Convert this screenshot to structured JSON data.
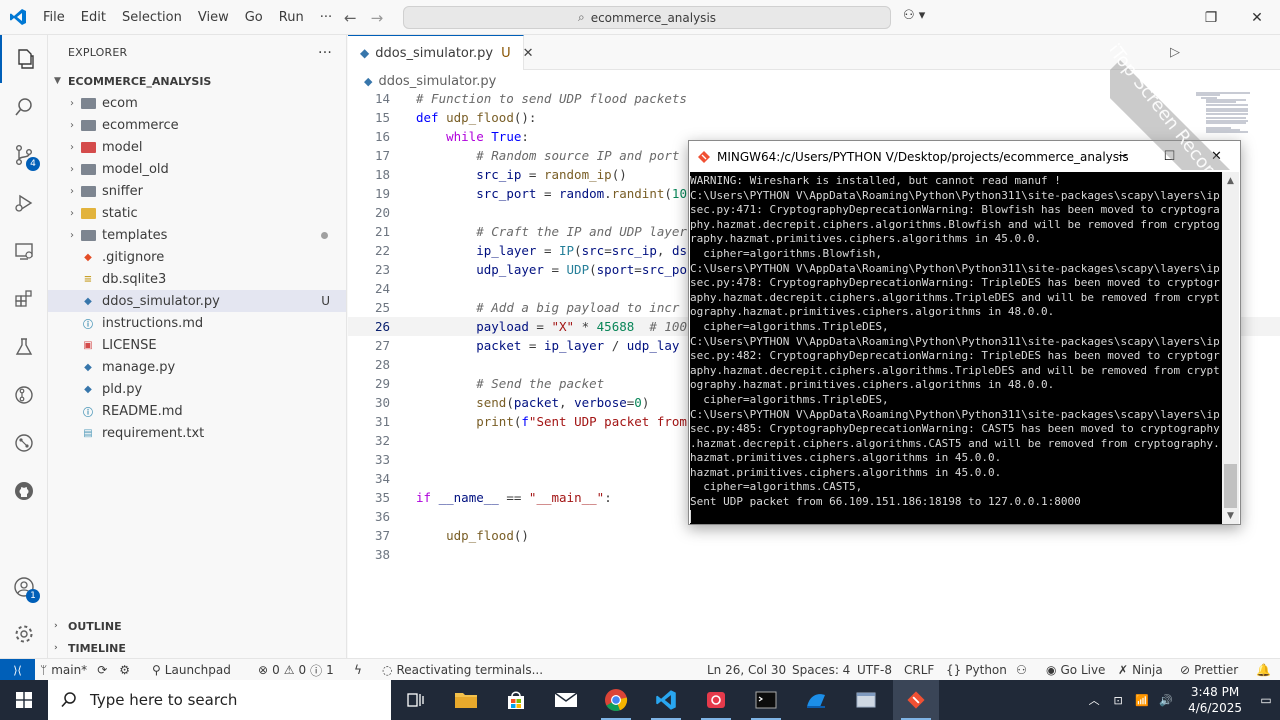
{
  "titlebar": {
    "menus": [
      "File",
      "Edit",
      "Selection",
      "View",
      "Go",
      "Run",
      "···"
    ],
    "search_text": "ecommerce_analysis"
  },
  "activity": {
    "source_control_badge": "4",
    "accounts_badge": "1"
  },
  "sidebar": {
    "title": "EXPLORER",
    "more": "···",
    "root": "ECOMMERCE_ANALYSIS",
    "items": [
      {
        "label": "ecom",
        "kind": "folder"
      },
      {
        "label": "ecommerce",
        "kind": "folder"
      },
      {
        "label": "model",
        "kind": "folder-red"
      },
      {
        "label": "model_old",
        "kind": "folder"
      },
      {
        "label": "sniffer",
        "kind": "folder"
      },
      {
        "label": "static",
        "kind": "folder-yellow"
      },
      {
        "label": "templates",
        "kind": "folder"
      },
      {
        "label": ".gitignore",
        "kind": "git"
      },
      {
        "label": "db.sqlite3",
        "kind": "db"
      },
      {
        "label": "ddos_simulator.py",
        "kind": "python",
        "status": "U"
      },
      {
        "label": "instructions.md",
        "kind": "info"
      },
      {
        "label": "LICENSE",
        "kind": "license"
      },
      {
        "label": "manage.py",
        "kind": "python"
      },
      {
        "label": "pld.py",
        "kind": "python"
      },
      {
        "label": "README.md",
        "kind": "info"
      },
      {
        "label": "requirement.txt",
        "kind": "text"
      }
    ],
    "outline": "OUTLINE",
    "timeline": "TIMELINE"
  },
  "editor": {
    "tab_label": "ddos_simulator.py",
    "tab_status": "U",
    "breadcrumb": "ddos_simulator.py",
    "lines": [
      {
        "n": "14",
        "text": "# Function to send UDP flood packets"
      },
      {
        "n": "15",
        "text": "def udp_flood():"
      },
      {
        "n": "16",
        "text": "    while True:"
      },
      {
        "n": "17",
        "text": "        # Random source IP and port"
      },
      {
        "n": "18",
        "text": "        src_ip = random_ip()"
      },
      {
        "n": "19",
        "text": "        src_port = random.randint(10"
      },
      {
        "n": "20",
        "text": ""
      },
      {
        "n": "21",
        "text": "        # Craft the IP and UDP layer"
      },
      {
        "n": "22",
        "text": "        ip_layer = IP(src=src_ip, ds"
      },
      {
        "n": "23",
        "text": "        udp_layer = UDP(sport=src_po"
      },
      {
        "n": "24",
        "text": ""
      },
      {
        "n": "25",
        "text": "        # Add a big payload to incr"
      },
      {
        "n": "26",
        "text": "        payload = \"X\" * 45688  # 100"
      },
      {
        "n": "27",
        "text": "        packet = ip_layer / udp_lay"
      },
      {
        "n": "28",
        "text": ""
      },
      {
        "n": "29",
        "text": "        # Send the packet"
      },
      {
        "n": "30",
        "text": "        send(packet, verbose=0)"
      },
      {
        "n": "31",
        "text": "        print(f\"Sent UDP packet from"
      },
      {
        "n": "32",
        "text": ""
      },
      {
        "n": "33",
        "text": ""
      },
      {
        "n": "34",
        "text": ""
      },
      {
        "n": "35",
        "text": "if __name__ == \"__main__\":"
      },
      {
        "n": "36",
        "text": ""
      },
      {
        "n": "37",
        "text": "    udp_flood()"
      },
      {
        "n": "38",
        "text": ""
      }
    ]
  },
  "terminal": {
    "title": "MINGW64:/c/Users/PYTHON V/Desktop/projects/ecommerce_analysis",
    "lines": [
      "WARNING: Wireshark is installed, but cannot read manuf !",
      "C:\\Users\\PYTHON V\\AppData\\Roaming\\Python\\Python311\\site-packages\\scapy\\layers\\ip",
      "sec.py:471: CryptographyDeprecationWarning: Blowfish has been moved to cryptogra",
      "phy.hazmat.decrepit.ciphers.algorithms.Blowfish and will be removed from cryptog",
      "raphy.hazmat.primitives.ciphers.algorithms in 45.0.0.",
      "  cipher=algorithms.Blowfish,",
      "C:\\Users\\PYTHON V\\AppData\\Roaming\\Python\\Python311\\site-packages\\scapy\\layers\\ip",
      "sec.py:478: CryptographyDeprecationWarning: TripleDES has been moved to cryptogr",
      "aphy.hazmat.decrepit.ciphers.algorithms.TripleDES and will be removed from crypt",
      "ography.hazmat.primitives.ciphers.algorithms in 48.0.0.",
      "  cipher=algorithms.TripleDES,",
      "C:\\Users\\PYTHON V\\AppData\\Roaming\\Python\\Python311\\site-packages\\scapy\\layers\\ip",
      "sec.py:482: CryptographyDeprecationWarning: TripleDES has been moved to cryptogr",
      "aphy.hazmat.decrepit.ciphers.algorithms.TripleDES and will be removed from crypt",
      "ography.hazmat.primitives.ciphers.algorithms in 48.0.0.",
      "  cipher=algorithms.TripleDES,",
      "C:\\Users\\PYTHON V\\AppData\\Roaming\\Python\\Python311\\site-packages\\scapy\\layers\\ip",
      "sec.py:485: CryptographyDeprecationWarning: CAST5 has been moved to cryptography",
      ".hazmat.decrepit.ciphers.algorithms.CAST5 and will be removed from cryptography.",
      "hazmat.primitives.ciphers.algorithms in 45.0.0.",
      "hazmat.primitives.ciphers.algorithms in 45.0.0.",
      "  cipher=algorithms.CAST5,",
      "Sent UDP packet from 66.109.151.186:18198 to 127.0.0.1:8000"
    ]
  },
  "statusbar": {
    "branch": "main*",
    "launchpad": "Launchpad",
    "errors": "0",
    "warnings": "0",
    "info": "1",
    "activity": "Reactivating terminals...",
    "position": "Ln 26, Col 30",
    "spaces": "Spaces: 4",
    "encoding": "UTF-8",
    "eol": "CRLF",
    "language": "Python",
    "golive": "Go Live",
    "ninja": "Ninja",
    "prettier": "Prettier"
  },
  "taskbar": {
    "search_placeholder": "Type here to search",
    "time": "3:48 PM",
    "date": "4/6/2025"
  },
  "watermark": {
    "text": "iTop Screen Recorder"
  },
  "colors": {
    "accent": "#005fb8",
    "keyword": "#0000ff",
    "string": "#a31515",
    "number": "#098658",
    "comment": "#6a6a6a"
  }
}
